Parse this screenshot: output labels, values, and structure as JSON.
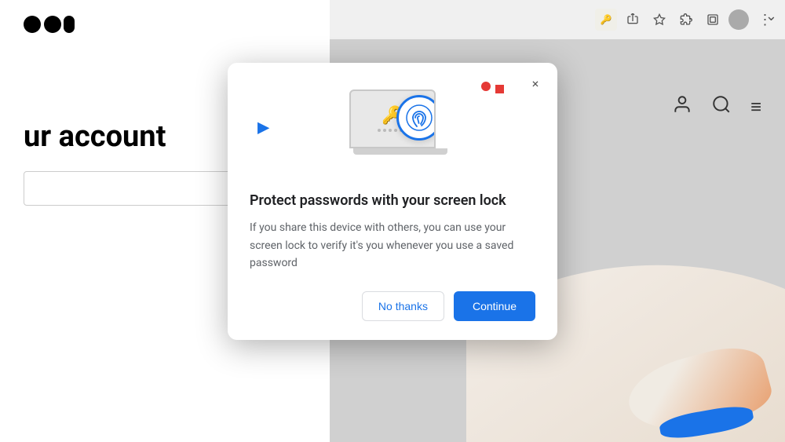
{
  "page": {
    "title": "Create your account"
  },
  "background": {
    "logo_circles": "medium-logo",
    "page_heading": "ur account"
  },
  "toolbar": {
    "chevron_label": "⌄",
    "key_icon": "🔑",
    "share_icon": "⬆",
    "bookmark_icon": "☆",
    "extensions_icon": "🧩",
    "tab_icon": "⧉",
    "menu_icon": "⋮"
  },
  "nav": {
    "account_icon": "👤",
    "search_icon": "🔍",
    "menu_icon": "≡"
  },
  "dialog": {
    "close_label": "×",
    "title": "Protect passwords with your screen lock",
    "body": "If you share this device with others, you can use your screen lock to verify it's you whenever you use a saved password",
    "no_thanks_label": "No thanks",
    "continue_label": "Continue"
  }
}
